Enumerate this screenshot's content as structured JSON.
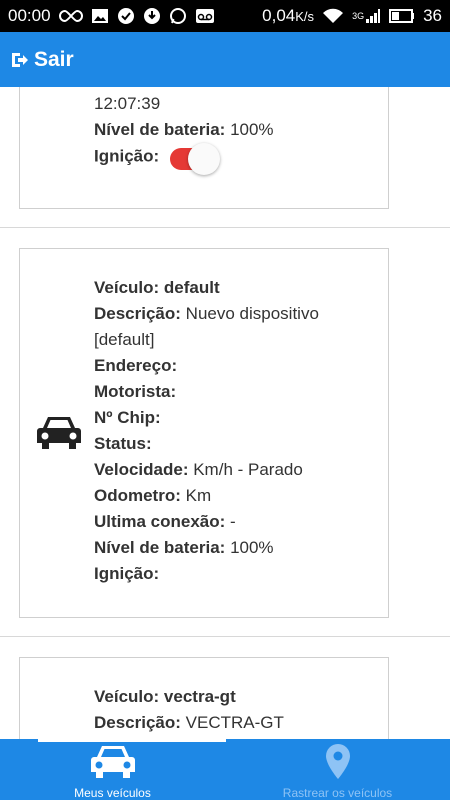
{
  "status_bar": {
    "time": "00:00",
    "data_speed": "0,04",
    "data_unit": "K/s",
    "network": "3G",
    "battery": "36"
  },
  "app_bar": {
    "exit_label": "Sair"
  },
  "cards": [
    {
      "time": "12:07:39",
      "battery_label": "Nível de bateria:",
      "battery_value": "100%",
      "ignition_label": "Ignição:",
      "ignition_on": true
    },
    {
      "fields": [
        {
          "label": "Veículo:",
          "value": "default"
        },
        {
          "label": "Descrição:",
          "value": "Nuevo dispositivo [default]"
        },
        {
          "label": "Endereço:",
          "value": ""
        },
        {
          "label": "Motorista:",
          "value": ""
        },
        {
          "label": "Nº Chip:",
          "value": ""
        },
        {
          "label": "Status:",
          "value": ""
        },
        {
          "label": "Velocidade:",
          "value": "Km/h - Parado"
        },
        {
          "label": "Odometro:",
          "value": "Km"
        },
        {
          "label": "Ultima conexão:",
          "value": "-"
        },
        {
          "label": "Nível de bateria:",
          "value": "100%"
        },
        {
          "label": "Ignição:",
          "value": ""
        }
      ]
    },
    {
      "fields": [
        {
          "label": "Veículo:",
          "value": "vectra-gt"
        },
        {
          "label": "Descrição:",
          "value": "VECTRA-GT"
        }
      ]
    }
  ],
  "bottom_nav": {
    "items": [
      {
        "label": "Meus veículos",
        "icon": "car-icon",
        "active": true
      },
      {
        "label": "Rastrear os veículos",
        "icon": "map-marker-icon",
        "active": false
      }
    ]
  },
  "colors": {
    "primary": "#1e88e5",
    "toggle_on": "#e53935"
  }
}
